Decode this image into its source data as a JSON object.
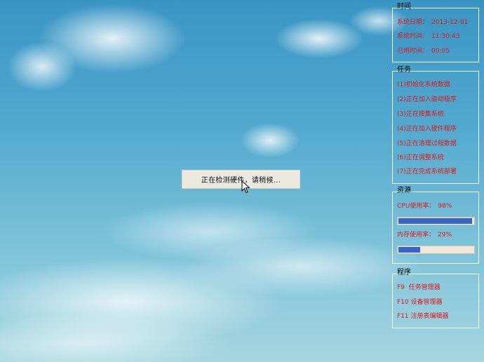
{
  "time_panel": {
    "title": "时间",
    "system_date_label": "系统日期：",
    "system_date_value": "2013-12-01",
    "system_time_label": "系统时间：",
    "system_time_value": "11:30:43",
    "elapsed_label": "已用时间：",
    "elapsed_value": "00:05"
  },
  "tasks_panel": {
    "title": "任务",
    "items": [
      "(1)初始化系统数据",
      "(2)正在加入驱动程序",
      "(3)正在搜集系统",
      "(4)正在加入硬件程序",
      "(5)正在清理过程数据",
      "(6)正在调整系统",
      "(7)正在完成系统部署"
    ]
  },
  "resources_panel": {
    "title": "资源",
    "cpu_label": "CPU使用率：",
    "cpu_value": "98%",
    "cpu_fraction": 0.98,
    "mem_label": "内存使用率：",
    "mem_value": "29%",
    "mem_fraction": 0.29
  },
  "programs_panel": {
    "title": "程序",
    "items": [
      "F9  任务管理器",
      "F10 设备管理器",
      "F11 注册表编辑器"
    ]
  },
  "dialog": {
    "message": "正在检测硬件，请稍候..."
  },
  "colors": {
    "accent_text": "#e01818",
    "progress_fill": "#3566c8",
    "progress_track": "#ede8da"
  }
}
